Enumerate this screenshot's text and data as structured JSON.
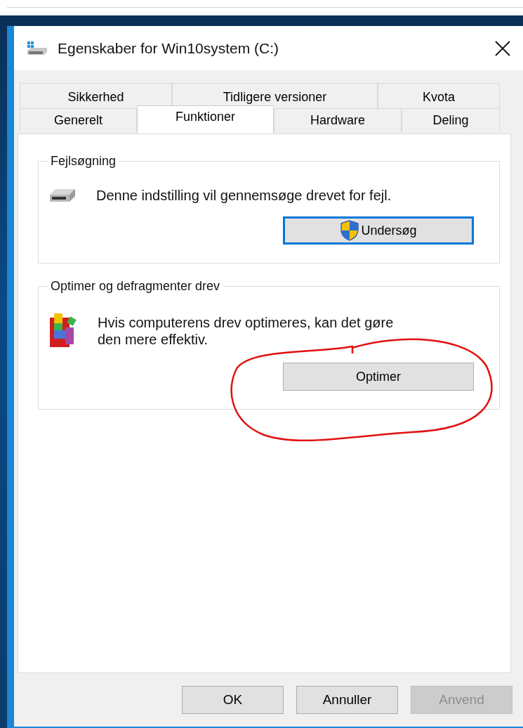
{
  "window": {
    "title": "Egenskaber for Win10system (C:)"
  },
  "tab_rows": [
    [
      {
        "label": "Sikkerhed",
        "selected": false
      },
      {
        "label": "Tidligere versioner",
        "selected": false
      },
      {
        "label": "Kvota",
        "selected": false
      }
    ],
    [
      {
        "label": "Generelt",
        "selected": false
      },
      {
        "label": "Funktioner",
        "selected": true
      },
      {
        "label": "Hardware",
        "selected": false
      },
      {
        "label": "Deling",
        "selected": false
      }
    ]
  ],
  "groups": [
    {
      "title": "Fejlsøgning",
      "kind": "drive",
      "text": "Denne indstilling vil gennemsøge drevet for fejl.",
      "button": {
        "label": "Undersøg",
        "focused": true,
        "elevated": true
      }
    },
    {
      "title": "Optimer og defragmenter drev",
      "kind": "defrag",
      "text": "Hvis computerens drev optimeres, kan det gøre den mere effektiv.",
      "button": {
        "label": "Optimer",
        "focused": false,
        "elevated": false
      }
    }
  ],
  "annotations": [
    {
      "kind": "circle"
    }
  ],
  "buttons": [
    {
      "label": "OK",
      "disabled": false
    },
    {
      "label": "Annuller",
      "disabled": false
    },
    {
      "label": "Anvend",
      "disabled": true
    }
  ]
}
